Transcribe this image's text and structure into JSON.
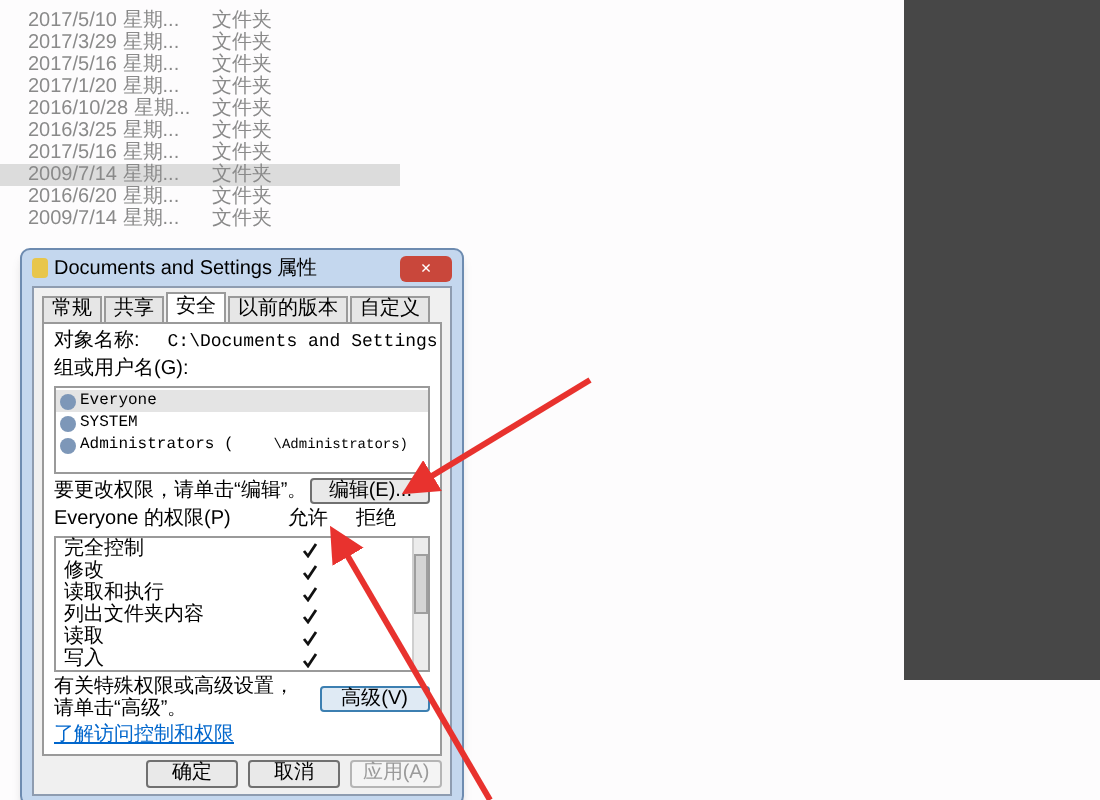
{
  "file_list": {
    "rows": [
      {
        "date": "2017/5/10 星期...",
        "type": "文件夹",
        "selected": false
      },
      {
        "date": "2017/3/29 星期...",
        "type": "文件夹",
        "selected": false
      },
      {
        "date": "2017/5/16 星期...",
        "type": "文件夹",
        "selected": false
      },
      {
        "date": "2017/1/20 星期...",
        "type": "文件夹",
        "selected": false
      },
      {
        "date": "2016/10/28 星期...",
        "type": "文件夹",
        "selected": false
      },
      {
        "date": "2016/3/25 星期...",
        "type": "文件夹",
        "selected": false
      },
      {
        "date": "2017/5/16 星期...",
        "type": "文件夹",
        "selected": false
      },
      {
        "date": "2009/7/14 星期...",
        "type": "文件夹",
        "selected": true
      },
      {
        "date": "2016/6/20 星期...",
        "type": "文件夹",
        "selected": false
      },
      {
        "date": "2009/7/14 星期...",
        "type": "文件夹",
        "selected": false
      }
    ]
  },
  "dialog": {
    "title": "Documents and Settings 属性",
    "close": "×",
    "tabs": [
      {
        "label": "常规",
        "selected": false
      },
      {
        "label": "共享",
        "selected": false
      },
      {
        "label": "安全",
        "selected": true
      },
      {
        "label": "以前的版本",
        "selected": false
      },
      {
        "label": "自定义",
        "selected": false
      }
    ],
    "object_label": "对象名称:",
    "object_path": "C:\\Documents and Settings",
    "group_label": "组或用户名(G):",
    "users": [
      {
        "name": "Everyone",
        "selected": true
      },
      {
        "name": "SYSTEM",
        "selected": false
      },
      {
        "name": "Administrators (",
        "detail": "\\Administrators)",
        "selected": false
      }
    ],
    "change_hint": "要更改权限，请单击“编辑”。",
    "edit_button": "编辑(E)...",
    "permissions_label": "Everyone 的权限(P)",
    "columns": [
      "允许",
      "拒绝"
    ],
    "permissions": [
      {
        "name": "完全控制",
        "allow": true,
        "deny": false
      },
      {
        "name": "修改",
        "allow": true,
        "deny": false
      },
      {
        "name": "读取和执行",
        "allow": true,
        "deny": false
      },
      {
        "name": "列出文件夹内容",
        "allow": true,
        "deny": false
      },
      {
        "name": "读取",
        "allow": true,
        "deny": false
      },
      {
        "name": "写入",
        "allow": true,
        "deny": false
      }
    ],
    "advanced_hint": "有关特殊权限或高级设置，请单击“高级”。",
    "advanced_button": "高级(V)",
    "link": "了解访问控制和权限",
    "buttons": [
      {
        "label": "确定",
        "disabled": false
      },
      {
        "label": "取消",
        "disabled": false
      },
      {
        "label": "应用(A)",
        "disabled": true
      }
    ]
  }
}
